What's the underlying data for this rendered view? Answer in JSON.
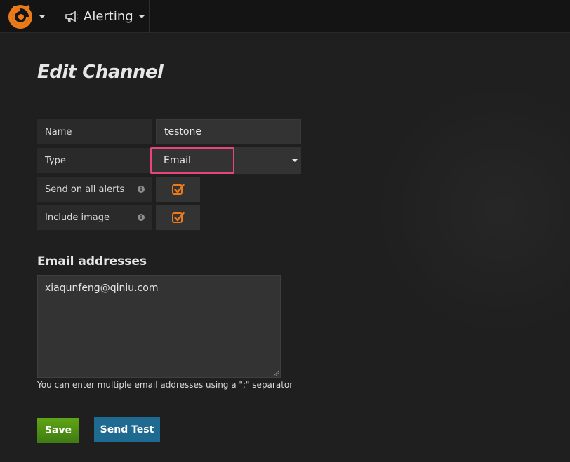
{
  "nav": {
    "logo_icon": "grafana-logo-icon",
    "section_icon": "megaphone-icon",
    "section_title": "Alerting"
  },
  "page": {
    "title": "Edit Channel"
  },
  "form": {
    "name_label": "Name",
    "name_value": "testone",
    "type_label": "Type",
    "type_value": "Email",
    "send_all_label": "Send on all alerts",
    "send_all_checked": true,
    "include_image_label": "Include image",
    "include_image_checked": true,
    "info_glyph": "i"
  },
  "email": {
    "section_label": "Email addresses",
    "addresses": "xiaqunfeng@qiniu.com",
    "help_text": "You can enter multiple email addresses using a \";\" separator"
  },
  "buttons": {
    "save": "Save",
    "send_test": "Send Test"
  },
  "colors": {
    "accent_orange": "#eb7b18",
    "highlight_pink": "#e8457a",
    "save_green": "#4f8f14",
    "test_blue": "#1f6a91"
  }
}
